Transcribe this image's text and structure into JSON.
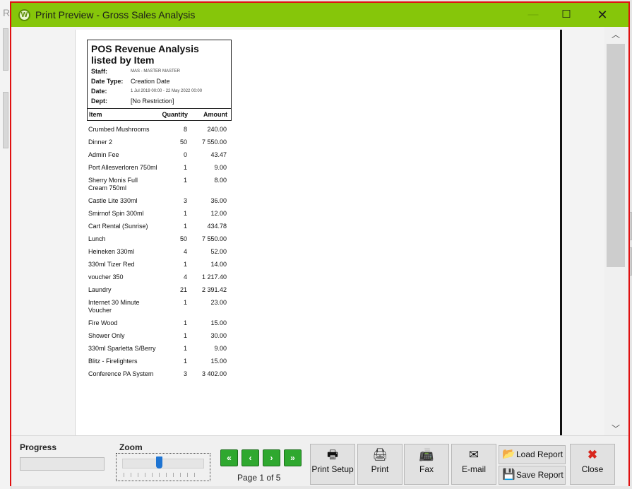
{
  "window": {
    "title": "Print Preview - Gross Sales Analysis",
    "background_letter": "R"
  },
  "report": {
    "title": "POS Revenue Analysis listed by Item",
    "staff_key": "Staff:",
    "staff_val": "MAS - MASTER MASTER",
    "date_type_key": "Date Type:",
    "date_type_val": "Creation Date",
    "date_key": "Date:",
    "date_val": "1 Jul 2019 00:00 - 22 May 2022 00:00",
    "dept_key": "Dept:",
    "dept_val": "[No Restriction]",
    "columns": {
      "item": "Item",
      "qty": "Quantity",
      "amount": "Amount"
    },
    "rows": [
      {
        "item": "Crumbed Mushrooms",
        "qty": "8",
        "amount": "240.00"
      },
      {
        "item": "Dinner 2",
        "qty": "50",
        "amount": "7 550.00"
      },
      {
        "item": "Admin Fee",
        "qty": "0",
        "amount": "43.47"
      },
      {
        "item": "Port Allesverloren 750ml",
        "qty": "1",
        "amount": "9.00"
      },
      {
        "item": "Sherry Monis Full Cream 750ml",
        "qty": "1",
        "amount": "8.00"
      },
      {
        "item": "Castle Lite 330ml",
        "qty": "3",
        "amount": "36.00"
      },
      {
        "item": "Smirnof Spin 300ml",
        "qty": "1",
        "amount": "12.00"
      },
      {
        "item": "Cart Rental (Sunrise)",
        "qty": "1",
        "amount": "434.78"
      },
      {
        "item": "Lunch",
        "qty": "50",
        "amount": "7 550.00"
      },
      {
        "item": "Heineken 330ml",
        "qty": "4",
        "amount": "52.00"
      },
      {
        "item": "330ml Tizer Red",
        "qty": "1",
        "amount": "14.00"
      },
      {
        "item": "voucher 350",
        "qty": "4",
        "amount": "1 217.40"
      },
      {
        "item": "Laundry",
        "qty": "21",
        "amount": "2 391.42"
      },
      {
        "item": "Internet 30 Minute Voucher",
        "qty": "1",
        "amount": "23.00"
      },
      {
        "item": "Fire Wood",
        "qty": "1",
        "amount": "15.00"
      },
      {
        "item": "Shower Only",
        "qty": "1",
        "amount": "30.00"
      },
      {
        "item": "330ml Sparletta S/Berry",
        "qty": "1",
        "amount": "9.00"
      },
      {
        "item": "Blitz - Firelighters",
        "qty": "1",
        "amount": "15.00"
      },
      {
        "item": "Conference PA System",
        "qty": "3",
        "amount": "3 402.00"
      }
    ]
  },
  "toolbar": {
    "progress_label": "Progress",
    "progress_value": 0,
    "zoom_label": "Zoom",
    "zoom_level": 0.45,
    "page_label": "Page 1 of 5",
    "nav": {
      "first": "«",
      "prev": "‹",
      "next": "›",
      "last": "»"
    },
    "print_setup": "Print Setup",
    "print": "Print",
    "fax": "Fax",
    "email": "E-mail",
    "load_report": "Load Report",
    "save_report": "Save Report",
    "close": "Close"
  },
  "icons": {
    "app": "app-icon",
    "minimize": "minimize-icon",
    "maximize": "maximize-icon",
    "close": "close-icon"
  },
  "colors": {
    "titlebar": "#86c60a",
    "frame": "#e01010",
    "nav_green": "#2fa82f",
    "zoom_thumb": "#1e74d2"
  }
}
